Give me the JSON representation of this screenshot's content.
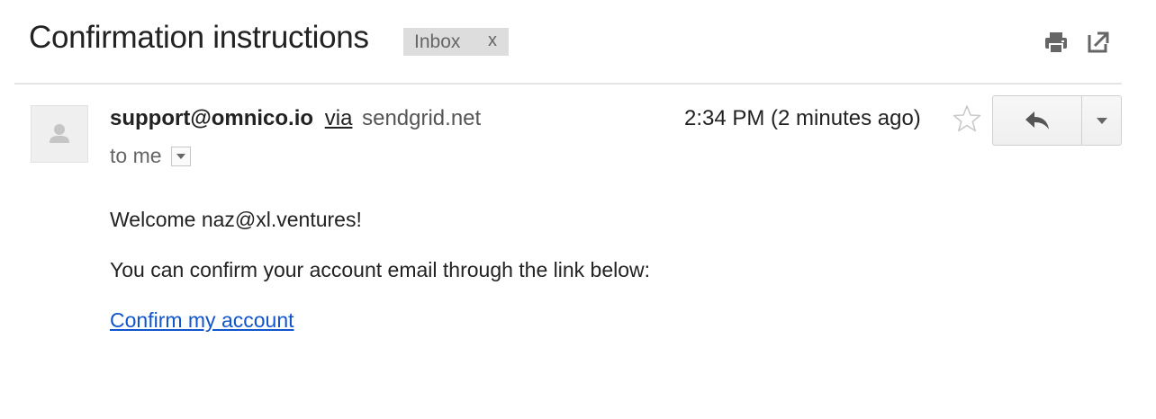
{
  "email": {
    "subject": "Confirmation instructions",
    "label": {
      "name": "Inbox",
      "remove": "x"
    },
    "icons": {
      "print": "print-icon",
      "popout": "open-in-new-window-icon",
      "star": "star-icon",
      "reply": "reply-icon",
      "more": "chevron-down-icon",
      "avatar": "person-icon"
    },
    "sender": {
      "email": "support@omnico.io",
      "via_label": "via",
      "via_domain": "sendgrid.net"
    },
    "recipient": "to me",
    "timestamp": "2:34 PM (2 minutes ago)",
    "body": {
      "greeting": "Welcome naz@xl.ventures!",
      "instruction": "You can confirm your account email through the link below:",
      "link_text": "Confirm my account"
    }
  },
  "colors": {
    "link": "#1155cc",
    "chip_bg": "#dddddd",
    "text": "#222222",
    "muted": "#666666"
  }
}
